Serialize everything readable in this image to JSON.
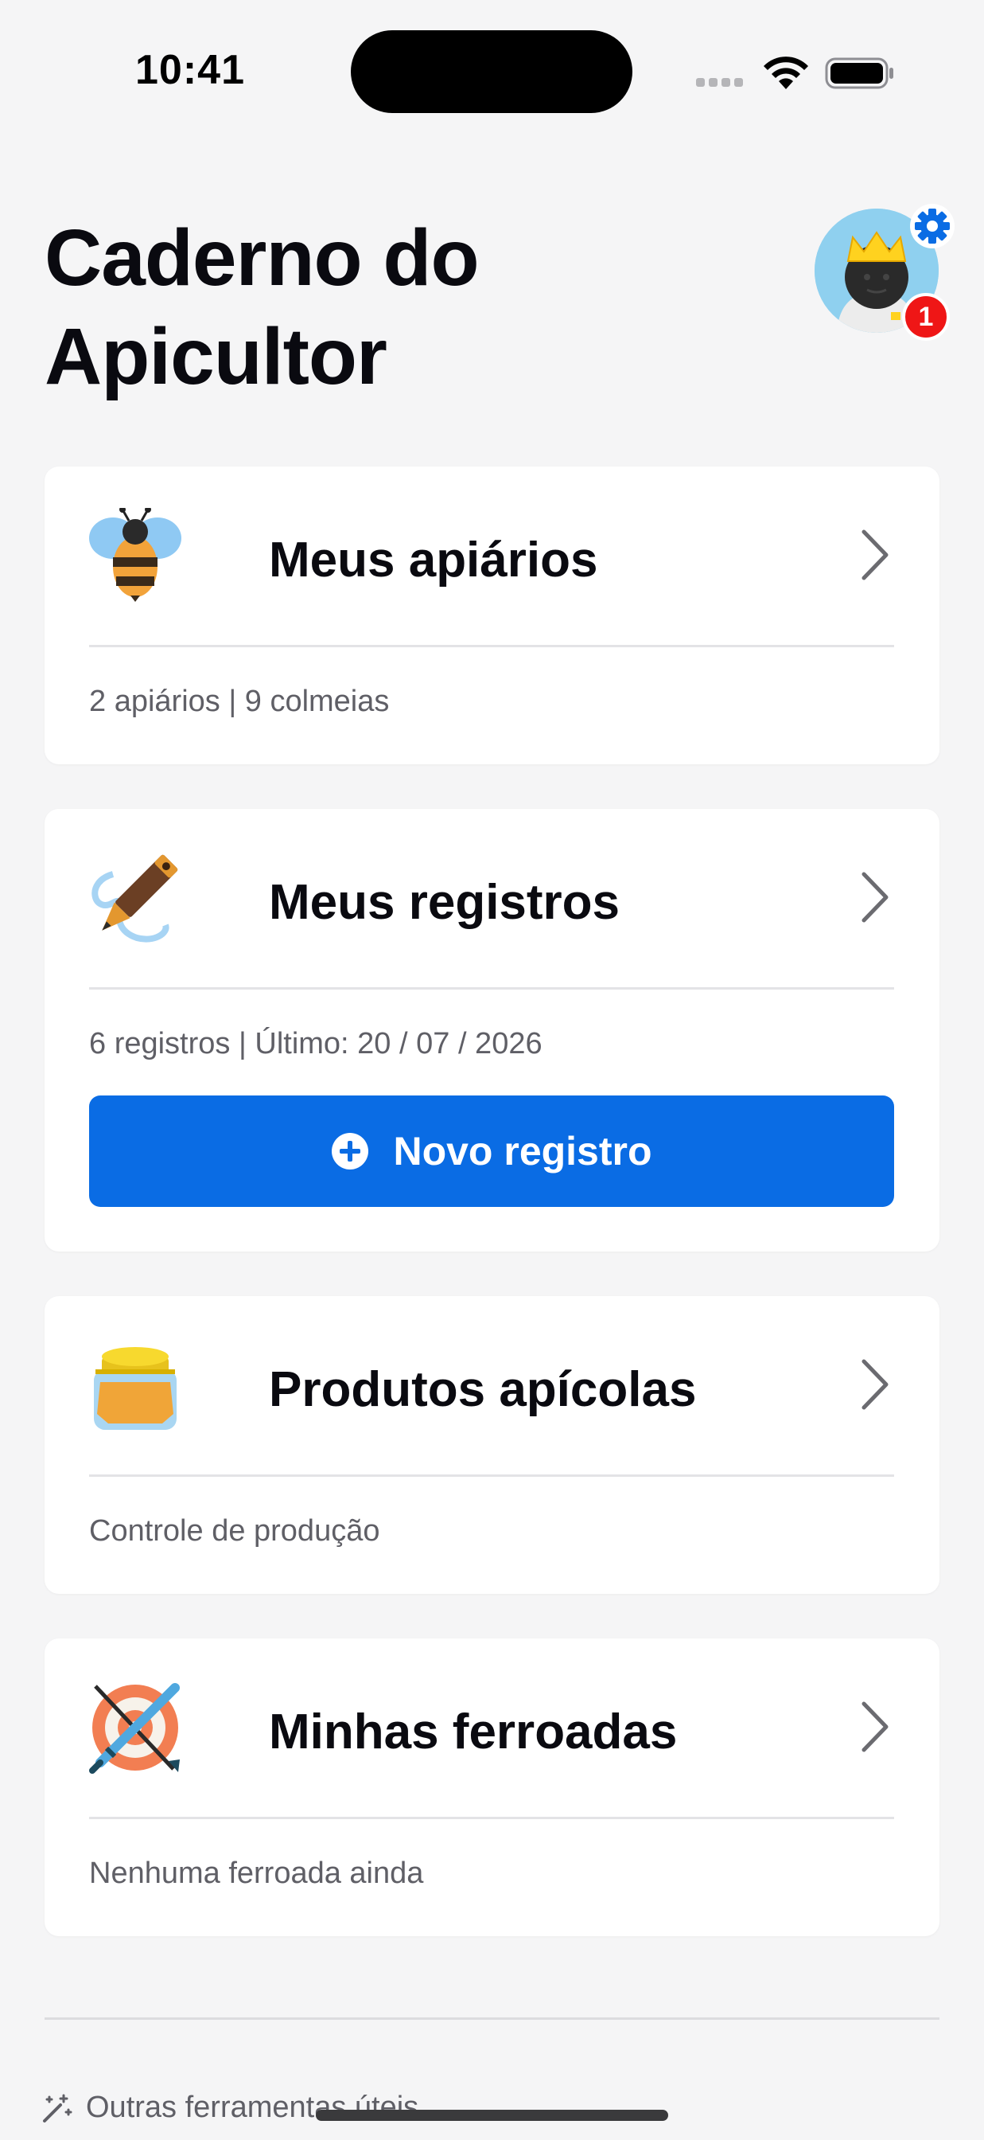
{
  "status_bar": {
    "time": "10:41"
  },
  "header": {
    "title_line1": "Caderno do",
    "title_line2": "Apicultor",
    "notification_count": "1"
  },
  "cards": {
    "apiaries": {
      "title": "Meus apiários",
      "subtitle": "2 apiários | 9 colmeias",
      "icon": "bee-icon"
    },
    "records": {
      "title": "Meus registros",
      "subtitle": "6 registros | Último: 20 / 07 / 2026",
      "button_label": "Novo registro",
      "icon": "pencil-icon"
    },
    "products": {
      "title": "Produtos apícolas",
      "subtitle": "Controle de produção",
      "icon": "honey-jar-icon"
    },
    "stings": {
      "title": "Minhas ferroadas",
      "subtitle": "Nenhuma ferroada ainda",
      "icon": "target-sting-icon"
    }
  },
  "footer": {
    "link_label": "Outras ferramentas úteis"
  },
  "colors": {
    "accent": "#0a6ce4",
    "badge": "#ef1616",
    "background": "#f5f5f6"
  }
}
